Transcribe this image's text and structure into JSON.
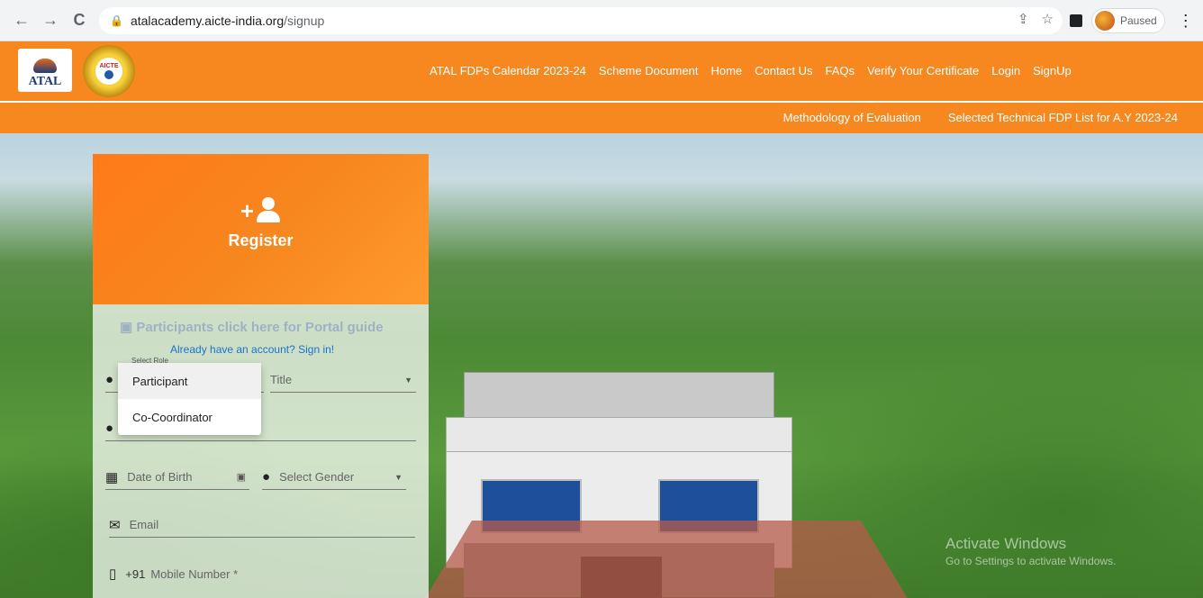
{
  "browser": {
    "url_host": "atalacademy.aicte-india.org",
    "url_path": "/signup",
    "profile_status": "Paused"
  },
  "header": {
    "logo_text": "ATAL",
    "seal_text": "AICTE",
    "nav": [
      "ATAL FDPs Calendar 2023-24",
      "Scheme Document",
      "Home",
      "Contact Us",
      "FAQs",
      "Verify Your Certificate",
      "Login",
      "SignUp"
    ],
    "subnav": [
      "Methodology of Evaluation",
      "Selected Technical FDP List for A.Y 2023-24"
    ]
  },
  "card": {
    "title": "Register",
    "guide_link": "Participants click here for Portal guide",
    "signin_link": "Already have an account? Sign in!",
    "role_label": "Select Role",
    "title_placeholder": "Title",
    "dob_placeholder": "Date of Birth",
    "gender_placeholder": "Select Gender",
    "email_placeholder": "Email",
    "country_code": "+91",
    "mobile_placeholder": "Mobile Number *"
  },
  "role_dropdown": {
    "options": [
      "Participant",
      "Co-Coordinator"
    ]
  },
  "watermark": {
    "line1": "Activate Windows",
    "line2": "Go to Settings to activate Windows."
  },
  "colors": {
    "brand_orange": "#f7871f",
    "link_blue": "#1a73c8"
  }
}
